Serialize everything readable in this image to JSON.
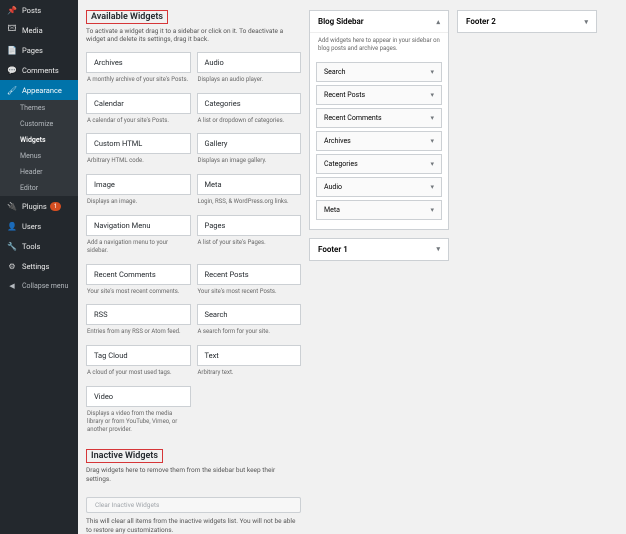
{
  "sidebar": {
    "items": [
      {
        "icon": "📌",
        "label": "Posts"
      },
      {
        "icon": "🖾",
        "label": "Media"
      },
      {
        "icon": "📄",
        "label": "Pages"
      },
      {
        "icon": "💬",
        "label": "Comments"
      }
    ],
    "appearance": {
      "icon": "🖌",
      "label": "Appearance"
    },
    "submenu": [
      "Themes",
      "Customize",
      "Widgets",
      "Menus",
      "Header",
      "Editor"
    ],
    "submenu_active": "Widgets",
    "items2": [
      {
        "icon": "🔌",
        "label": "Plugins",
        "badge": "1"
      },
      {
        "icon": "👤",
        "label": "Users"
      },
      {
        "icon": "🔧",
        "label": "Tools"
      },
      {
        "icon": "⚙",
        "label": "Settings"
      }
    ],
    "collapse": {
      "icon": "◀",
      "label": "Collapse menu"
    }
  },
  "available": {
    "title": "Available Widgets",
    "instructions": "To activate a widget drag it to a sidebar or click on it. To deactivate a widget and delete its settings, drag it back.",
    "widgets": [
      {
        "name": "Archives",
        "desc": "A monthly archive of your site's Posts."
      },
      {
        "name": "Audio",
        "desc": "Displays an audio player."
      },
      {
        "name": "Calendar",
        "desc": "A calendar of your site's Posts."
      },
      {
        "name": "Categories",
        "desc": "A list or dropdown of categories."
      },
      {
        "name": "Custom HTML",
        "desc": "Arbitrary HTML code."
      },
      {
        "name": "Gallery",
        "desc": "Displays an image gallery."
      },
      {
        "name": "Image",
        "desc": "Displays an image."
      },
      {
        "name": "Meta",
        "desc": "Login, RSS, & WordPress.org links."
      },
      {
        "name": "Navigation Menu",
        "desc": "Add a navigation menu to your sidebar."
      },
      {
        "name": "Pages",
        "desc": "A list of your site's Pages."
      },
      {
        "name": "Recent Comments",
        "desc": "Your site's most recent comments."
      },
      {
        "name": "Recent Posts",
        "desc": "Your site's most recent Posts."
      },
      {
        "name": "RSS",
        "desc": "Entries from any RSS or Atom feed."
      },
      {
        "name": "Search",
        "desc": "A search form for your site."
      },
      {
        "name": "Tag Cloud",
        "desc": "A cloud of your most used tags."
      },
      {
        "name": "Text",
        "desc": "Arbitrary text."
      },
      {
        "name": "Video",
        "desc": "Displays a video from the media library or from YouTube, Vimeo, or another provider."
      }
    ]
  },
  "inactive": {
    "title": "Inactive Widgets",
    "instructions": "Drag widgets here to remove them from the sidebar but keep their settings.",
    "clear_button": "Clear Inactive Widgets",
    "clear_note": "This will clear all items from the inactive widgets list. You will not be able to restore any customizations."
  },
  "areas": {
    "blog_sidebar": {
      "title": "Blog Sidebar",
      "desc": "Add widgets here to appear in your sidebar on blog posts and archive pages.",
      "widgets": [
        "Search",
        "Recent Posts",
        "Recent Comments",
        "Archives",
        "Categories",
        "Audio",
        "Meta"
      ]
    },
    "footer1": {
      "title": "Footer 1"
    },
    "footer2": {
      "title": "Footer 2"
    }
  }
}
